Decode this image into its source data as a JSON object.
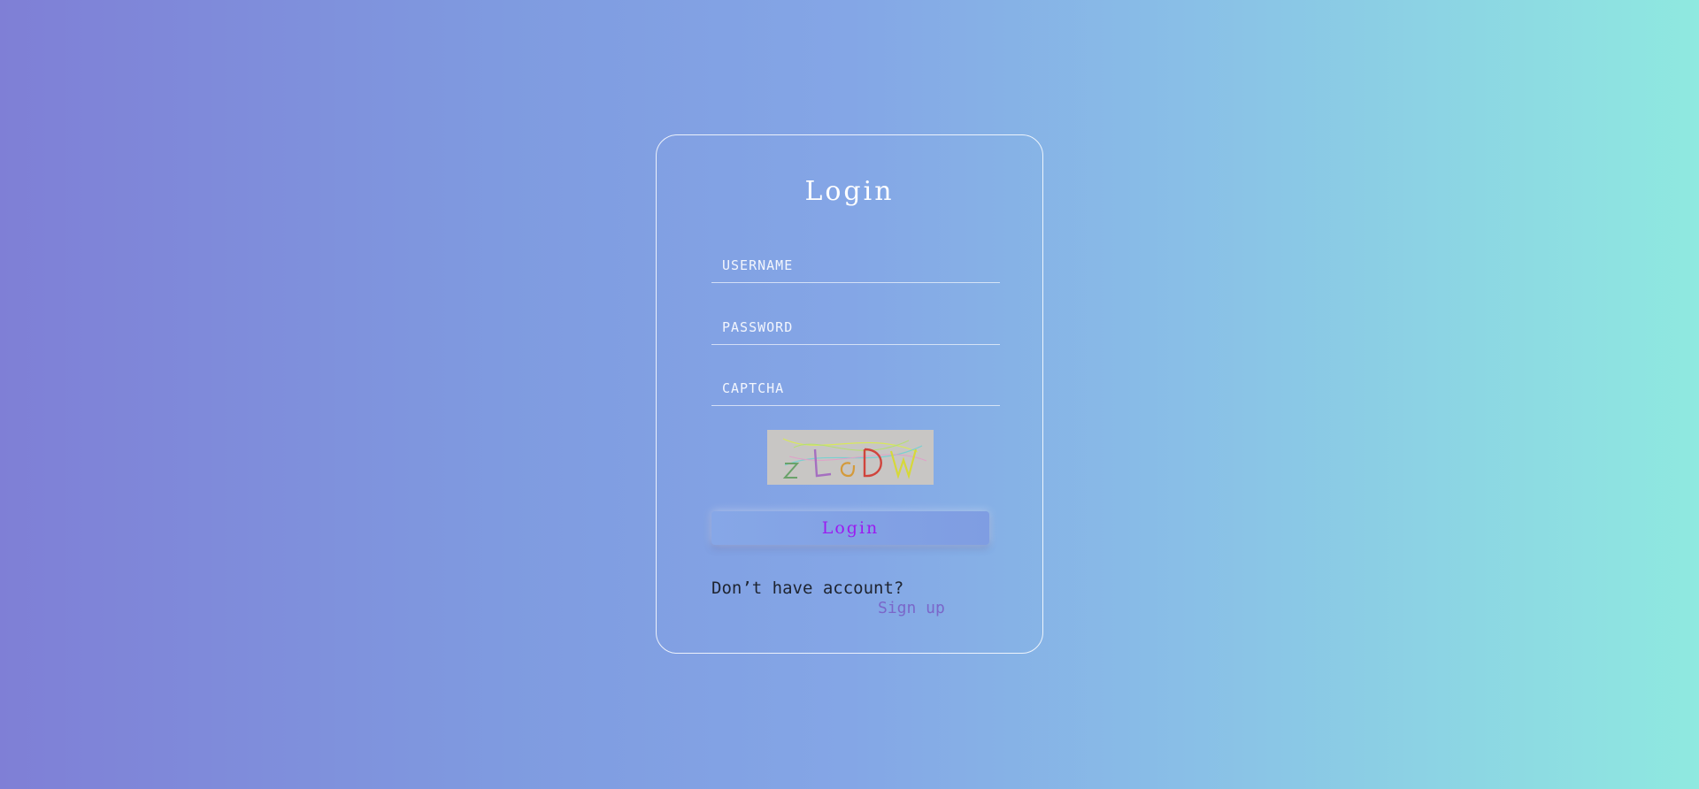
{
  "login_card": {
    "title": "Login",
    "username": {
      "value": "",
      "placeholder": "USERNAME"
    },
    "password": {
      "value": "",
      "placeholder": "PASSWORD"
    },
    "captcha_field": {
      "value": "",
      "placeholder": "CAPTCHA"
    },
    "captcha_image": {
      "text": "zLcDW",
      "background": "#c8c6c4"
    },
    "login_button": "Login",
    "no_account_text": "Don’t have account?",
    "signup_link": "Sign up"
  },
  "colors": {
    "gradient_left": "#7f7fd6",
    "gradient_right": "#8fe9e0",
    "button_text": "#9b1bf0",
    "link": "#7a66c9"
  }
}
